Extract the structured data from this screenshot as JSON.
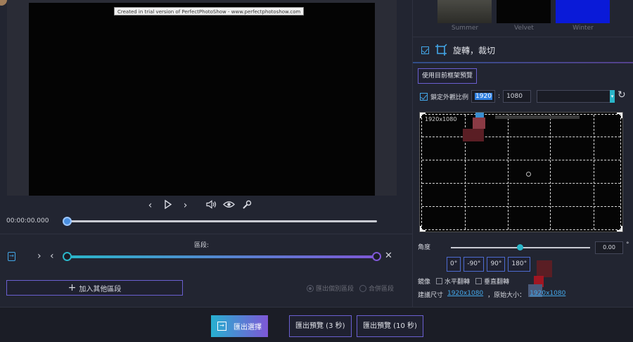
{
  "preview": {
    "watermark": "Created in trial version of PerfectPhotoShow - www.perfectphotoshow.com",
    "timecode": "00:00:00.000",
    "controls": [
      "prev-frame",
      "play",
      "next-frame",
      "volume",
      "eye",
      "wrench"
    ]
  },
  "segment": {
    "label": "區段:",
    "progress_start": 0.0,
    "progress_end": 1.0,
    "add_button": "加入其他區段",
    "radio_options": [
      {
        "label": "匯出個別區段",
        "selected": true
      },
      {
        "label": "合併區段",
        "selected": false
      }
    ]
  },
  "filters": [
    {
      "name": "Summer",
      "color": "#3a3a36"
    },
    {
      "name": "Velvet",
      "color": "#050505"
    },
    {
      "name": "Winter",
      "color": "#0a1ad8"
    }
  ],
  "rotate_crop": {
    "title": "旋轉，裁切",
    "enabled": true,
    "use_frame_btn": "使用目前框架預覽",
    "lock_ratio_label": "鎖定外觀比例",
    "width": "1920",
    "separator": ":",
    "height": "1080",
    "crop_size": "1920x1080",
    "angle_label": "角度",
    "angle_value": "0.00",
    "angle_unit": "°",
    "rotate_buttons": [
      "0°",
      "-90°",
      "90°",
      "180°"
    ],
    "mirror_label": "鏡像",
    "flip_h": "水平翻轉",
    "flip_v": "垂直翻轉",
    "suggested_label": "建議尺寸",
    "suggested_value": "1920x1080",
    "original_label": "，原始大小：",
    "original_value": "1920x1080"
  },
  "bottom": {
    "export": "匯出選擇",
    "preview3": "匯出預覽 (3 秒)",
    "preview10": "匯出預覽 (10 秒)"
  },
  "colors": {
    "accent_teal": "#2ab6c9",
    "accent_purple": "#7e57d6",
    "link_blue": "#43a7e8"
  }
}
